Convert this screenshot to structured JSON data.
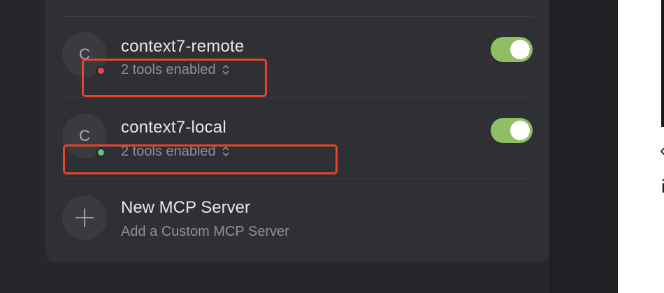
{
  "servers": [
    {
      "avatar_letter": "C",
      "name": "context7-remote",
      "status_color": "#e5484d",
      "tools_label": "2 tools enabled",
      "enabled": true
    },
    {
      "avatar_letter": "C",
      "name": "context7-local",
      "status_color": "#5fc27b",
      "tools_label": "2 tools enabled",
      "enabled": true
    }
  ],
  "new_server": {
    "icon": "plus-icon",
    "title": "New MCP Server",
    "subtitle": "Add a Custom MCP Server"
  },
  "right_panel_glyphs": [
    "‹",
    "i"
  ],
  "colors": {
    "toggle_on": "#8fbf63",
    "highlight_annotation": "#e8432b",
    "card_bg": "#2f3034"
  }
}
